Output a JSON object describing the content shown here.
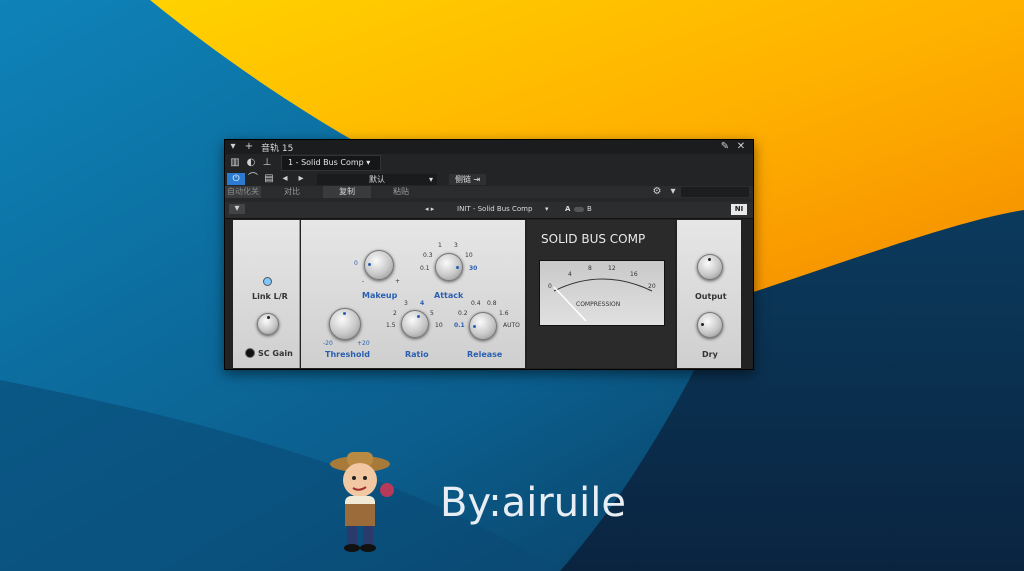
{
  "window": {
    "track_title": "音轨 15",
    "preset_slot": "1 - Solid Bus Comp",
    "default_preset": "默认",
    "sidechain_label": "侧链",
    "buttons": [
      "自动化关",
      "对比",
      "复制",
      "粘贴"
    ]
  },
  "plugin": {
    "preset_name": "INIT - Solid Bus Comp",
    "ab_a": "A",
    "ab_b": "B",
    "title": "SOLID BUS COMP",
    "meter_label": "COMPRESSION",
    "meter_scale": [
      "0",
      "4",
      "8",
      "12",
      "16",
      "20"
    ],
    "link_label": "Link L/R",
    "sc_gain_label": "SC Gain",
    "makeup_label": "Makeup",
    "makeup_scale": [
      "0",
      "-",
      "+"
    ],
    "attack_label": "Attack",
    "attack_scale": [
      "1",
      "3",
      "0.3",
      "10",
      "0.1",
      "30"
    ],
    "threshold_label": "Threshold",
    "threshold_scale": [
      "-20",
      "+20"
    ],
    "ratio_label": "Ratio",
    "ratio_scale": [
      "3",
      "4",
      "2",
      "5",
      "1.5",
      "10"
    ],
    "release_label": "Release",
    "release_scale": [
      "0.4",
      "0.8",
      "0.2",
      "1.6",
      "0.1",
      "AUTO"
    ],
    "output_label": "Output",
    "dry_label": "Dry"
  },
  "watermark": "By:airuile",
  "colors": {
    "accent": "#2a7bd1",
    "knob_accent": "#2a5fb0"
  }
}
